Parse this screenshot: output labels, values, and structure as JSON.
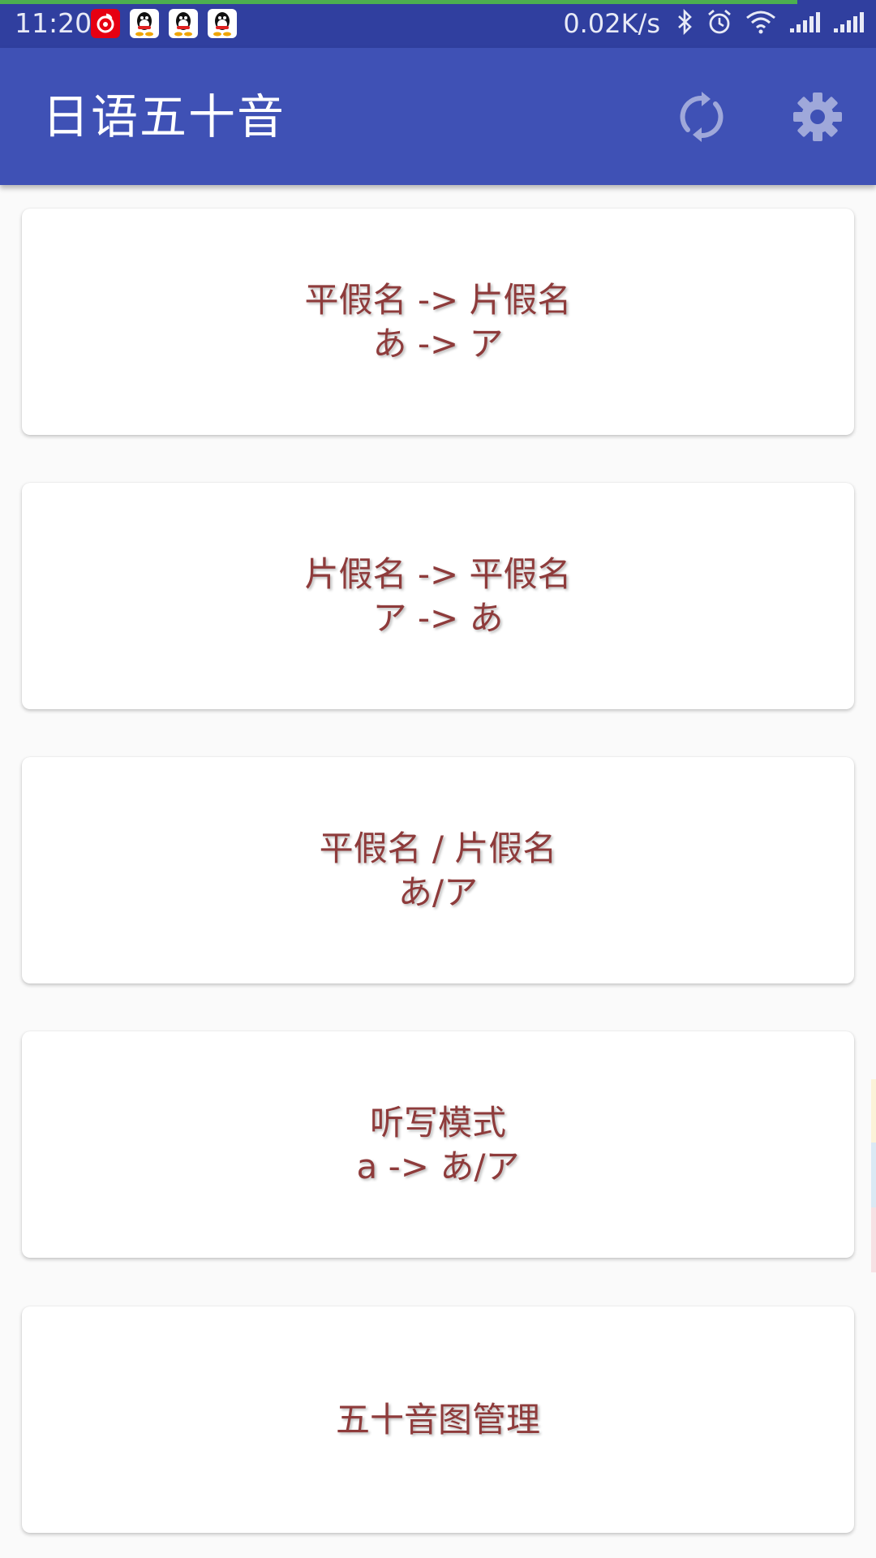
{
  "status_bar": {
    "time": "11:20",
    "net_speed": "0.02K/s",
    "load_progress_percent": 91,
    "notifications": [
      "netease-music-icon",
      "qq-icon",
      "qq-icon",
      "qq-icon"
    ],
    "system_icons": [
      "bluetooth-icon",
      "alarm-icon",
      "wifi-icon",
      "signal-icon",
      "signal-icon"
    ]
  },
  "app_bar": {
    "title": "日语五十音",
    "actions": [
      "refresh-icon",
      "settings-icon"
    ]
  },
  "cards": [
    {
      "line1": "平假名 -> 片假名",
      "line2": "あ -> ア"
    },
    {
      "line1": "片假名 -> 平假名",
      "line2": "ア -> あ"
    },
    {
      "line1": "平假名 / 片假名",
      "line2": "あ/ア"
    },
    {
      "line1": "听写模式",
      "line2": "a -> あ/ア"
    },
    {
      "line1": "五十音图管理"
    }
  ],
  "colors": {
    "status_bar": "#303f9f",
    "app_bar": "#3f51b5",
    "card_text": "#8e3b3b",
    "background": "#fafafa",
    "progress": "#4caf50"
  }
}
